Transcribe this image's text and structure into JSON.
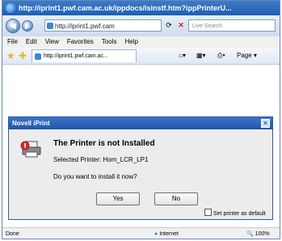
{
  "browser": {
    "title": "http://iprint1.pwf.cam.ac.uk/ippdocs/isinstf.htm?ippPrinterU...",
    "address": "http://iprint1.pwf.cam",
    "search_placeholder": "Live Search",
    "menu": [
      "File",
      "Edit",
      "View",
      "Favorites",
      "Tools",
      "Help"
    ],
    "tab_title": "http://iprint1.pwf.cam.ac...",
    "page_label": "Page",
    "status": "Done",
    "zone": "Internet",
    "zoom": "100%"
  },
  "dialog": {
    "title": "Novell iPrint",
    "heading": "The Printer is not Installed",
    "selected_printer": "Selected Printer: Hom_LCR_LP1",
    "question": "Do you want to install it now?",
    "yes_label": "Yes",
    "no_label": "No",
    "default_label": "Set printer as default",
    "default_checked": false
  }
}
